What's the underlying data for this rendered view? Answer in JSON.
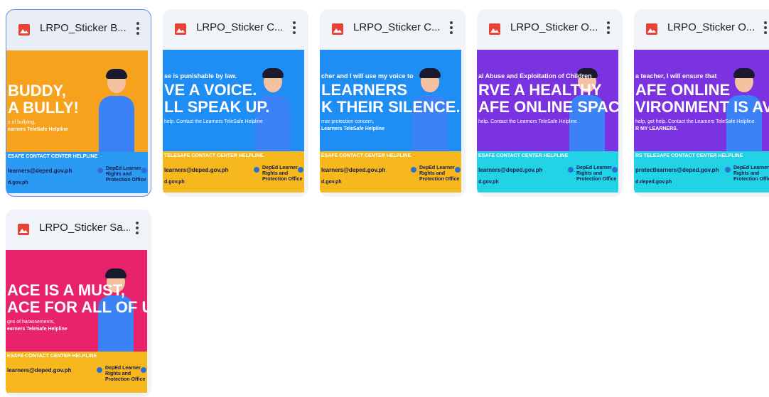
{
  "files": [
    {
      "name": "LRPO_Sticker B...",
      "selected": true,
      "bg": "#f6a21c",
      "banner_bg": "#2b9af3",
      "lines": [
        "",
        "BUDDY,",
        "A BULLY!",
        "s of bullying,",
        "earners TeleSafe Helpline"
      ],
      "banner_title": "ESAFE CONTACT CENTER HELPLINE",
      "email": "learners@deped.gov.ph",
      "office": "DepEd Learner Rights and Protection Office",
      "site": "d.gov.ph"
    },
    {
      "name": "LRPO_Sticker C...",
      "selected": false,
      "bg": "#1e8ef5",
      "banner_bg": "#f6b81c",
      "lines": [
        "se is punishable by law.",
        "VE A VOICE.",
        "LL SPEAK UP.",
        "help. Contact the Learners TeleSafe Helpline",
        ""
      ],
      "banner_title": "TELESAFE CONTACT CENTER HELPLINE",
      "email": "learners@deped.gov.ph",
      "office": "DepEd Learner Rights and Protection Office",
      "site": "d.gov.ph"
    },
    {
      "name": "LRPO_Sticker C...",
      "selected": false,
      "bg": "#1e8ef5",
      "banner_bg": "#f6b81c",
      "lines": [
        "cher and I will use my voice to",
        "LEARNERS",
        "K THEIR SILENCE.",
        "rner protection concern,",
        "Learners TeleSafe Helpline"
      ],
      "banner_title": "ESAFE CONTACT CENTER HELPLINE",
      "email": "learners@deped.gov.ph",
      "office": "DepEd Learner Rights and Protection Office",
      "site": "d.gov.ph"
    },
    {
      "name": "LRPO_Sticker O...",
      "selected": false,
      "bg": "#7b32e0",
      "banner_bg": "#22d3e6",
      "lines": [
        "al Abuse and Exploitation of Children",
        "RVE A HEALTHY",
        "AFE ONLINE SPACE.",
        "help. Contact the Learners TeleSafe Helpline",
        ""
      ],
      "banner_title": "ESAFE CONTACT CENTER HELPLINE",
      "email": "learners@deped.gov.ph",
      "office": "DepEd Learner Rights and Protection Office",
      "site": "d.gov.ph"
    },
    {
      "name": "LRPO_Sticker O...",
      "selected": false,
      "bg": "#7b32e0",
      "banner_bg": "#22d3e6",
      "lines": [
        "a teacher, I will ensure that",
        "AFE ONLINE",
        "VIRONMENT IS AVAILABLE",
        "help, get help. Contact the Learners TeleSafe Helpline",
        "R MY LEARNERS."
      ],
      "banner_title": "RS TELESAFE CONTACT CENTER HELPLINE",
      "email": "protectlearners@deped.gov.ph",
      "office": "DepEd Learner Rights and Protection Office",
      "site": "d.deped.gov.ph"
    },
    {
      "name": "LRPO_Sticker Sa...",
      "selected": false,
      "bg": "#e8236b",
      "banner_bg": "#f6b81c",
      "lines": [
        "",
        "ACE IS A MUST,",
        "ACE FOR ALL OF US!",
        "gns of harassements,",
        "earners TeleSafe Helpline"
      ],
      "banner_title": "ESAFE CONTACT CENTER HELPLINE",
      "email": "learners@deped.gov.ph",
      "office": "DepEd Learner Rights and Protection Office",
      "site": ""
    }
  ]
}
